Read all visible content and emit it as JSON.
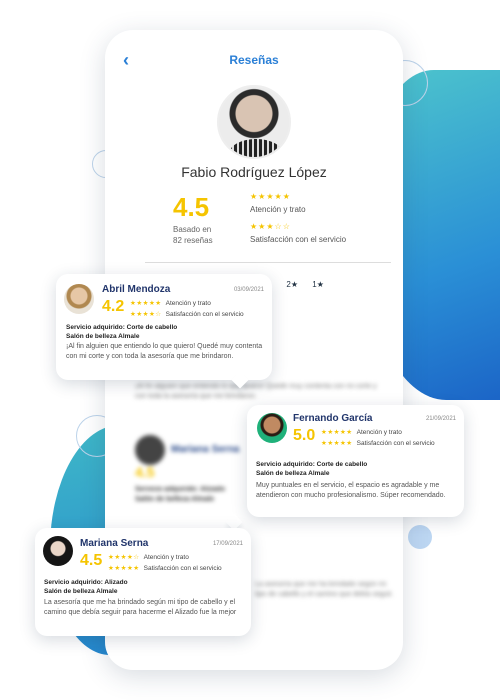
{
  "app": {
    "title": "Reseñas",
    "back_icon": "‹"
  },
  "profile": {
    "name": "Fabio Rodríguez López",
    "score": "4.5",
    "based_line1": "Basado en",
    "based_line2": "82 reseñas",
    "criteria": [
      {
        "stars": "★★★★★",
        "label": "Atención y trato"
      },
      {
        "stars": "★★★☆☆",
        "label": "Satisfacción con el servicio"
      }
    ]
  },
  "filters": [
    "★",
    "2★",
    "1★"
  ],
  "cards": [
    {
      "name": "Abril Mendoza",
      "date": "03/09/2021",
      "score": "4.2",
      "lines": [
        {
          "stars": "★★★★★",
          "label": "Atención y trato"
        },
        {
          "stars": "★★★★☆",
          "label": "Satisfacción con el servicio"
        }
      ],
      "service": "Servicio adquirido: Corte de cabello",
      "salon": "Salón de belleza Almale",
      "text": "¡Al fin alguien que entiendo lo que quiero! Quedé muy contenta con mi corte y con toda la asesoría que me brindaron."
    },
    {
      "name": "Fernando García",
      "date": "21/09/2021",
      "score": "5.0",
      "lines": [
        {
          "stars": "★★★★★",
          "label": "Atención y trato"
        },
        {
          "stars": "★★★★★",
          "label": "Satisfacción con el servicio"
        }
      ],
      "service": "Servicio adquirido: Corte de cabello",
      "salon": "Salón de belleza Almale",
      "text": "Muy puntuales en el servicio, el espacio es agradable y me atendieron con mucho profesionalismo. Súper recomendado."
    },
    {
      "name": "Mariana Serna",
      "date": "17/09/2021",
      "score": "4.5",
      "lines": [
        {
          "stars": "★★★★☆",
          "label": "Atención y trato"
        },
        {
          "stars": "★★★★★",
          "label": "Satisfacción con el servicio"
        }
      ],
      "service": "Servicio adquirido: Alizado",
      "salon": "Salón de belleza Almale",
      "text": "La asesoría que me ha brindado según mi tipo de cabello y el camino que debía seguir para hacerme el Alizado fue la mejor"
    }
  ],
  "colors": {
    "accent": "#2a7fd6",
    "star": "#f5c400",
    "name": "#21356b"
  }
}
